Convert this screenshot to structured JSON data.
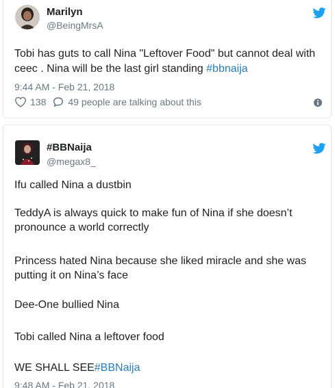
{
  "tweets": [
    {
      "display_name": "Marilyn",
      "handle": "@BeingMrsA",
      "lines": [
        {
          "text": "Tobi has guts to call Nina \"Leftover Food\" but cannot deal with"
        },
        {
          "text": "ceec . Nina will be the last girl standing ",
          "link": "#bbnaija"
        }
      ],
      "timestamp": "9:44 AM - Feb 21, 2018",
      "likes": "138",
      "replies_text": "49 people are talking about this",
      "icons": {
        "brand": "twitter-bird-icon",
        "like": "heart-icon",
        "reply": "speech-bubble-icon",
        "info": "info-icon"
      }
    },
    {
      "display_name": "#BBNaija",
      "handle": "@megax8_",
      "lines": [
        {
          "text": "Ifu called Nina a dustbin"
        },
        {
          "text": "TeddyA is always quick to make fun of Nina if she doesn’t"
        },
        {
          "text": "pronounce a world correctly"
        },
        {
          "text": "Princess hated Nina because she liked miracle and she was"
        },
        {
          "text": "putting it on Nina’s face"
        },
        {
          "text": "Dee-One bullied Nina"
        },
        {
          "text": "Tobi called Nina a leftover food"
        },
        {
          "text": "WE SHALL SEE",
          "link": "#BBNaija"
        }
      ],
      "timestamp": "9:48 AM - Feb 21, 2018",
      "icons": {
        "brand": "twitter-bird-icon"
      }
    }
  ],
  "colors": {
    "link": "#2b7bb9",
    "brand": "#1da1f2",
    "muted": "#697882",
    "text": "#1c2022",
    "border": "#e1e8ed"
  }
}
